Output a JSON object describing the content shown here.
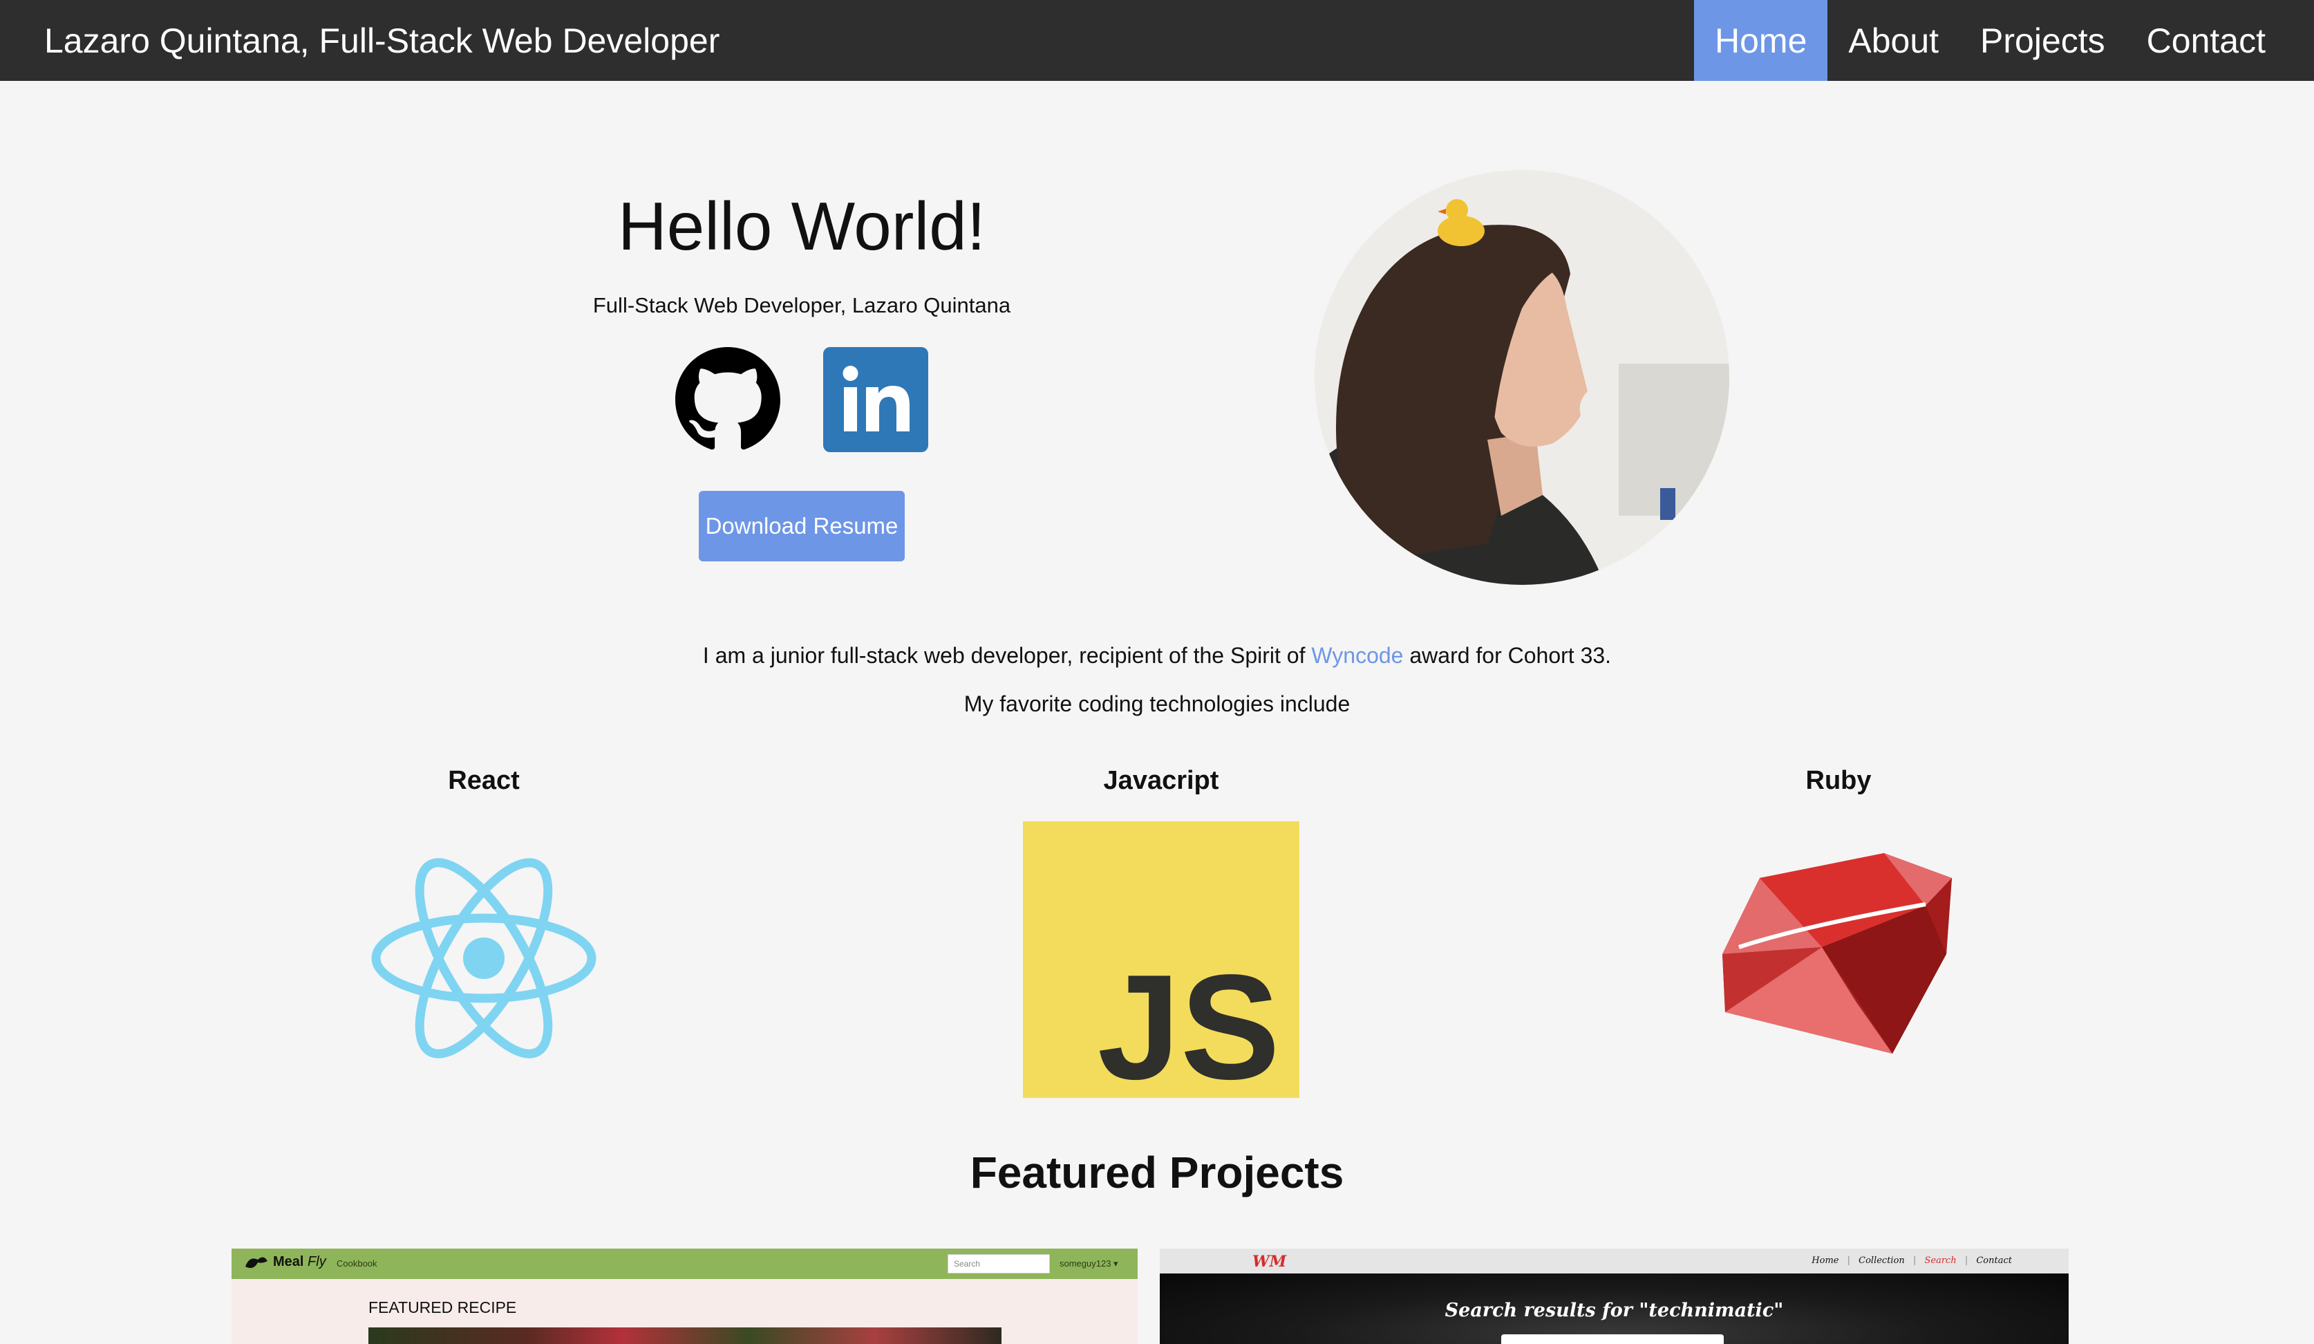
{
  "navbar": {
    "brand": "Lazaro Quintana, Full-Stack Web Developer",
    "items": [
      {
        "label": "Home",
        "active": true
      },
      {
        "label": "About",
        "active": false
      },
      {
        "label": "Projects",
        "active": false
      },
      {
        "label": "Contact",
        "active": false
      }
    ]
  },
  "hero": {
    "heading": "Hello World!",
    "subtitle": "Full-Stack Web Developer, Lazaro Quintana",
    "socials": [
      {
        "icon": "github-icon"
      },
      {
        "icon": "linkedin-icon"
      }
    ],
    "resume_button": "Download Resume"
  },
  "intro": {
    "before_link": "I am a junior full-stack web developer, recipient of the Spirit of ",
    "link": "Wyncode",
    "after_link": " award for Cohort 33.",
    "favorites": "My favorite coding technologies include"
  },
  "technologies": [
    {
      "name": "React",
      "icon": "react-icon"
    },
    {
      "name": "Javacript",
      "icon": "javascript-icon"
    },
    {
      "name": "Ruby",
      "icon": "ruby-icon"
    }
  ],
  "featured": {
    "heading": "Featured Projects",
    "project1": {
      "logo_main": "Meal ",
      "logo_italic": "Fly",
      "nav_link": "Cookbook",
      "search_placeholder": "Search",
      "user": "someguy123 ▾",
      "section_label": "FEATURED RECIPE"
    },
    "project2": {
      "logo": "WM",
      "nav": [
        "Home",
        "Collection",
        "Search",
        "Contact"
      ],
      "separator": "|",
      "title": "Search results for \"technimatic\""
    }
  },
  "colors": {
    "navbar_bg": "#2e2e2e",
    "accent": "#6d96e6",
    "page_bg": "#f5f5f5",
    "react": "#7fd4f2",
    "javascript": "#f3dc5c",
    "ruby": "#cc2a2a"
  }
}
